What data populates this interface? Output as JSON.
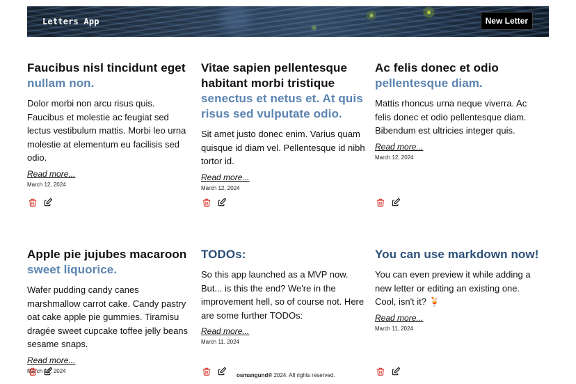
{
  "header": {
    "brand": "Letters App",
    "new_letter_label": "New Letter"
  },
  "cards": [
    {
      "title": "Faucibus nisl tincidunt eget",
      "title_highlight": "nullam non.",
      "excerpt": "Dolor morbi non arcu risus quis. Faucibus et molestie ac feugiat sed lectus vestibulum mattis. Morbi leo urna molestie at elementum eu facilisis sed odio.",
      "read_more": "Read more...",
      "date": "March 12, 2024"
    },
    {
      "title": "Vitae sapien pellentesque habitant morbi tristique",
      "title_highlight": "senectus et netus et. At quis risus sed vulputate odio.",
      "excerpt": "Sit amet justo donec enim. Varius quam quisque id diam vel. Pellentesque id nibh tortor id.",
      "read_more": "Read more...",
      "date": "March 12, 2024"
    },
    {
      "title": "Ac felis donec et odio",
      "title_highlight": "pellentesque diam.",
      "excerpt": "Mattis rhoncus urna neque viverra. Ac felis donec et odio pellentesque diam. Bibendum est ultricies integer quis.",
      "read_more": "Read more...",
      "date": "March 12, 2024"
    },
    {
      "title": "Apple pie jujubes macaroon",
      "title_highlight": "sweet liquorice.",
      "excerpt": "Wafer pudding candy canes marshmallow carrot cake. Candy pastry oat cake apple pie gummies. Tiramisu dragée sweet cupcake toffee jelly beans sesame snaps.",
      "read_more": "Read more...",
      "date": "March 12, 2024"
    },
    {
      "title": "TODOs:",
      "title_highlight": "",
      "excerpt": "So this app launched as a MVP now. But... is this the end? We're in the improvement hell, so of course not. Here are some further TODOs:",
      "read_more": "Read more...",
      "date": "March 11, 2024"
    },
    {
      "title": "You can use markdown now!",
      "title_highlight": "",
      "excerpt": "You can even preview it while adding a new letter or editing an existing one. Cool, isn't it? 🍹",
      "read_more": "Read more...",
      "date": "March 11, 2024"
    }
  ],
  "footer": {
    "brand": "osmangund®",
    "text": " 2024. All rights reserved."
  },
  "colors": {
    "highlight": "#5b84b1",
    "delete": "#d9342b",
    "edit": "#111111"
  },
  "icons": {
    "delete": "trash-icon",
    "edit": "edit-icon"
  }
}
